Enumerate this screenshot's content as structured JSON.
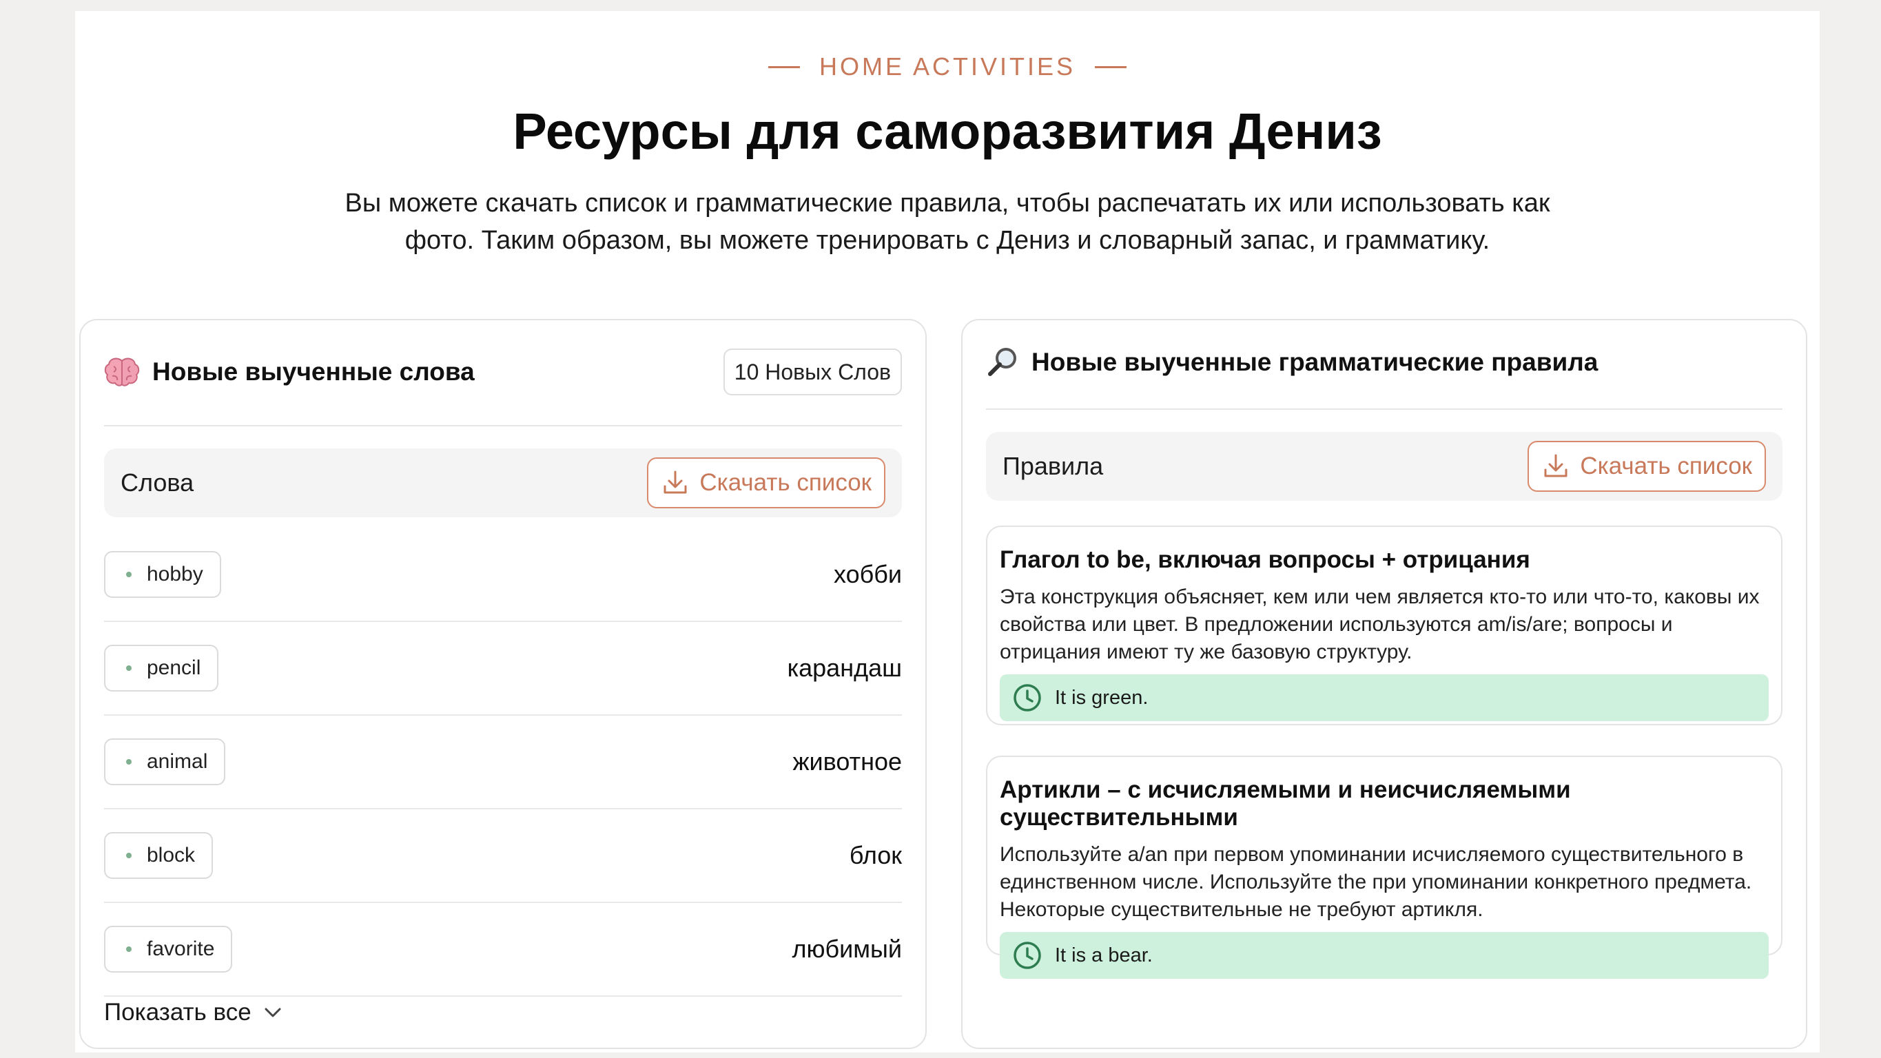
{
  "header": {
    "eyebrow": "HOME ACTIVITIES",
    "title": "Ресурсы для саморазвития Дениз",
    "subtitle": "Вы можете скачать список и грамматические правила, чтобы распечатать их или использовать как фото. Таким образом, вы можете тренировать с Дениз и словарный запас, и грамматику."
  },
  "words_card": {
    "icon": "brain-icon",
    "title": "Новые выученные слова",
    "badge": "10 Новых Слов",
    "toolbar_label": "Слова",
    "download_label": "Скачать список",
    "items": [
      {
        "word": "hobby",
        "translation": "хобби"
      },
      {
        "word": "pencil",
        "translation": "карандаш"
      },
      {
        "word": "animal",
        "translation": "животное"
      },
      {
        "word": "block",
        "translation": "блок"
      },
      {
        "word": "favorite",
        "translation": "любимый"
      }
    ],
    "show_all": "Показать все"
  },
  "grammar_card": {
    "icon": "magnifier-icon",
    "title": "Новые выученные грамматические правила",
    "toolbar_label": "Правила",
    "download_label": "Скачать список",
    "rules": [
      {
        "title": "Глагол to be, включая вопросы + отрицания",
        "text": "Эта конструкция объясняет, кем или чем является кто-то или что-то, каковы их свойства или цвет. В предложении используются am/is/are; вопросы и отрицания имеют ту же базовую структуру.",
        "example": "It is green."
      },
      {
        "title": "Артикли – с исчисляемыми и неисчисляемыми существительными",
        "text": "Используйте a/an при первом упоминании исчисляемого существительного в единственном числе. Используйте the при упоминании конкретного предмета. Некоторые существительные не требуют артикля.",
        "example": "It is a bear."
      }
    ]
  },
  "colors": {
    "accent": "#c8795a",
    "example_bg": "#cdf1dd",
    "example_icon": "#2e7d50"
  }
}
